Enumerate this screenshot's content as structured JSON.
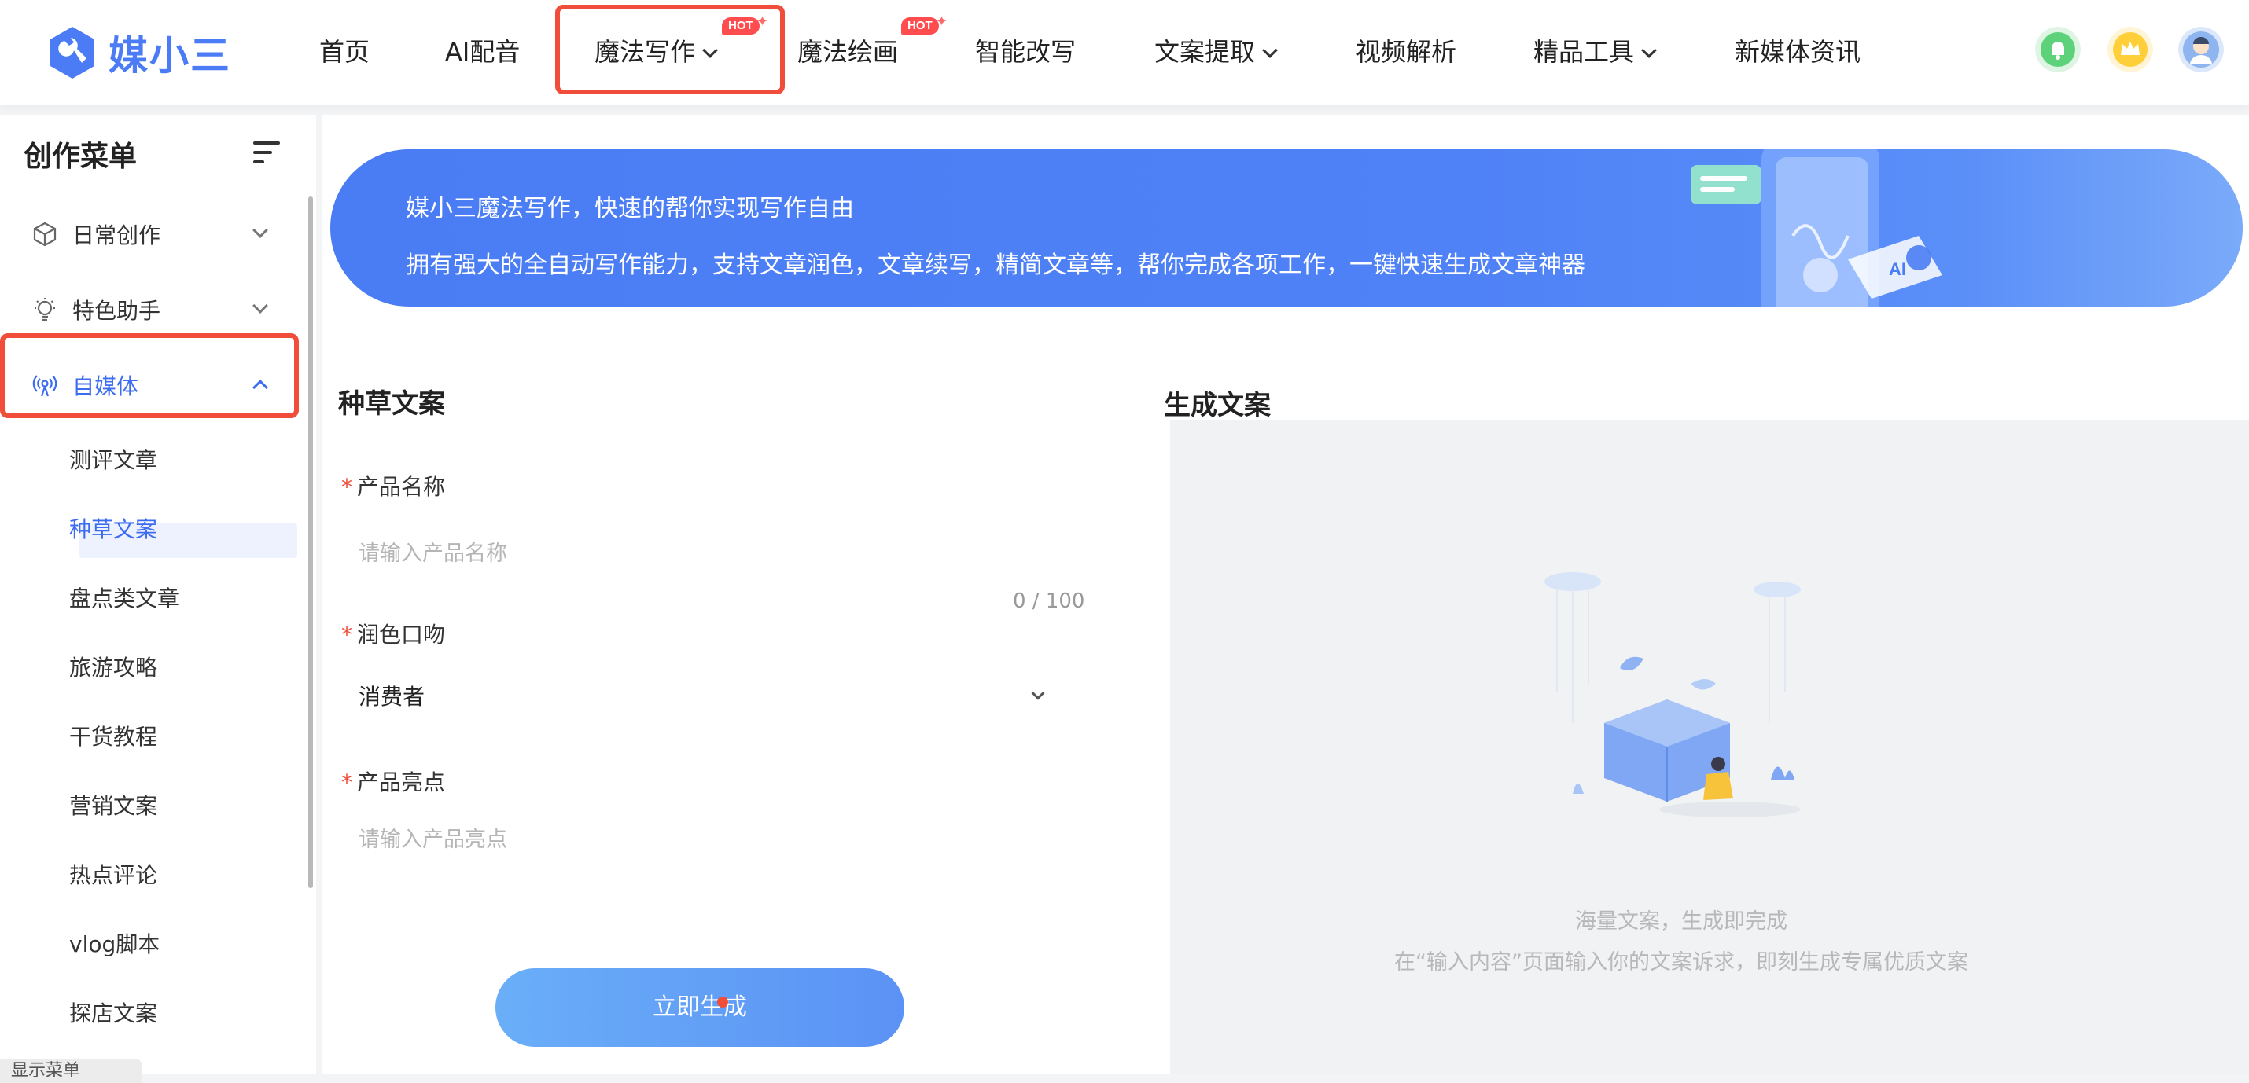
{
  "header": {
    "logo_text": "媒小三",
    "nav": [
      {
        "label": "首页",
        "has_dropdown": false,
        "hot": false
      },
      {
        "label": "AI配音",
        "has_dropdown": false,
        "hot": false
      },
      {
        "label": "魔法写作",
        "has_dropdown": true,
        "hot": true
      },
      {
        "label": "魔法绘画",
        "has_dropdown": false,
        "hot": true
      },
      {
        "label": "智能改写",
        "has_dropdown": false,
        "hot": false
      },
      {
        "label": "文案提取",
        "has_dropdown": true,
        "hot": false
      },
      {
        "label": "视频解析",
        "has_dropdown": false,
        "hot": false
      },
      {
        "label": "精品工具",
        "has_dropdown": true,
        "hot": false
      },
      {
        "label": "新媒体资讯",
        "has_dropdown": false,
        "hot": false
      }
    ],
    "hot_label": "HOT",
    "icons": [
      "bell-icon",
      "crown-icon",
      "user-avatar"
    ]
  },
  "sidebar": {
    "title": "创作菜单",
    "groups": [
      {
        "label": "日常创作",
        "icon": "cube-icon",
        "expanded": false
      },
      {
        "label": "特色助手",
        "icon": "bulb-icon",
        "expanded": false
      },
      {
        "label": "自媒体",
        "icon": "broadcast-icon",
        "expanded": true
      }
    ],
    "sub_items": [
      "测评文章",
      "种草文案",
      "盘点类文章",
      "旅游攻略",
      "干货教程",
      "营销文案",
      "热点评论",
      "vlog脚本",
      "探店文案"
    ],
    "active_sub": "种草文案",
    "bottom_tip": "显示菜单"
  },
  "banner": {
    "line1": "媒小三魔法写作，快速的帮你实现写作自由",
    "line2": "拥有强大的全自动写作能力，支持文章润色，文章续写，精简文章等，帮你完成各项工作，一键快速生成文章神器"
  },
  "form": {
    "title": "种草文案",
    "product_name_label": "产品名称",
    "product_name_placeholder": "请输入产品名称",
    "counter": "0 / 100",
    "tone_label": "润色口吻",
    "tone_value": "消费者",
    "highlight_label": "产品亮点",
    "highlight_placeholder": "请输入产品亮点",
    "submit_label": "立即生成"
  },
  "output": {
    "title": "生成文案",
    "empty_line1": "海量文案，生成即完成",
    "empty_line2": "在“输入内容”页面输入你的文案诉求，即刻生成专属优质文案"
  },
  "colors": {
    "accent": "#3c6cf0",
    "highlight_border": "#f04d3a",
    "banner": "#4a7cf4"
  }
}
